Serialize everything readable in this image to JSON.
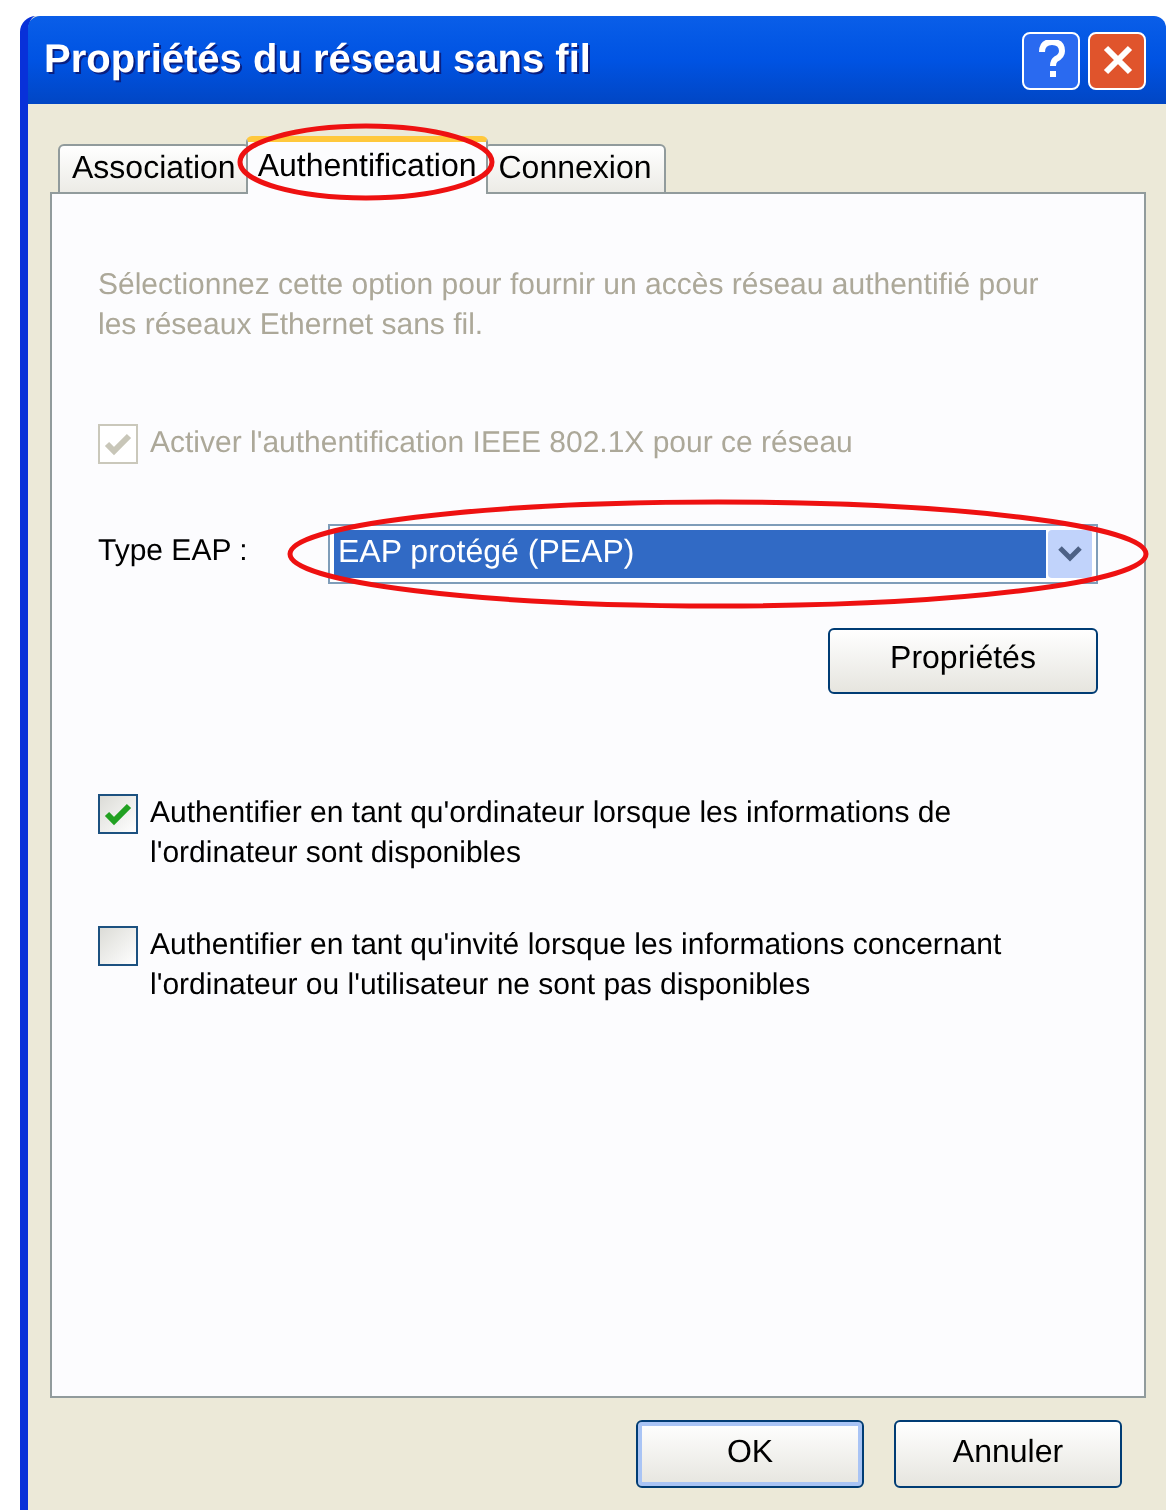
{
  "window": {
    "title": "Propriétés du réseau sans fil"
  },
  "tabs": [
    {
      "label": "Association",
      "selected": false,
      "circled": false
    },
    {
      "label": "Authentification",
      "selected": true,
      "circled": true
    },
    {
      "label": "Connexion",
      "selected": false,
      "circled": false
    }
  ],
  "description": {
    "text": "Sélectionnez cette option pour fournir un accès réseau authentifié pour les réseaux Ethernet sans fil.",
    "disabled": true
  },
  "enable_8021x": {
    "label": "Activer l'authentification IEEE 802.1X pour ce réseau",
    "checked": true,
    "disabled": true
  },
  "eap_type": {
    "label": "Type EAP :",
    "value": "EAP protégé (PEAP)",
    "circled": true
  },
  "properties_button": "Propriétés",
  "options": [
    {
      "label": "Authentifier en tant qu'ordinateur lorsque les informations de l'ordinateur sont disponibles",
      "checked": true,
      "disabled": false
    },
    {
      "label": "Authentifier en tant qu'invité lorsque les informations concernant l'ordinateur ou l'utilisateur ne sont pas disponibles",
      "checked": false,
      "disabled": false
    }
  ],
  "buttons": [
    {
      "label": "OK",
      "default": true
    },
    {
      "label": "Annuler",
      "default": false
    }
  ]
}
